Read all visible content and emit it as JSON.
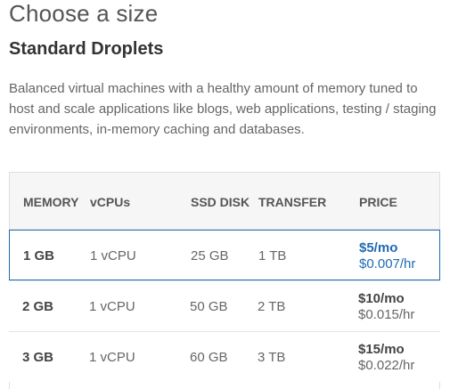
{
  "header": {
    "title": "Choose a size",
    "subtitle": "Standard Droplets",
    "description": "Balanced virtual machines with a healthy amount of memory tuned to host and scale applications like blogs, web applications, testing / staging environments, in-memory caching and databases."
  },
  "table": {
    "columns": {
      "memory": "MEMORY",
      "vcpus": "vCPUs",
      "ssd": "SSD DISK",
      "transfer": "TRANSFER",
      "price": "PRICE"
    },
    "rows": [
      {
        "memory": "1 GB",
        "vcpus": "1 vCPU",
        "ssd": "25 GB",
        "transfer": "1 TB",
        "monthly": "$5/mo",
        "hourly": "$0.007/hr",
        "selected": true
      },
      {
        "memory": "2 GB",
        "vcpus": "1 vCPU",
        "ssd": "50 GB",
        "transfer": "2 TB",
        "monthly": "$10/mo",
        "hourly": "$0.015/hr",
        "selected": false
      },
      {
        "memory": "3 GB",
        "vcpus": "1 vCPU",
        "ssd": "60 GB",
        "transfer": "3 TB",
        "monthly": "$15/mo",
        "hourly": "$0.022/hr",
        "selected": false
      }
    ]
  },
  "colors": {
    "selected_accent": "#1e6ab5",
    "header_bg": "#f6f6f6",
    "border": "#dfdfdf"
  }
}
